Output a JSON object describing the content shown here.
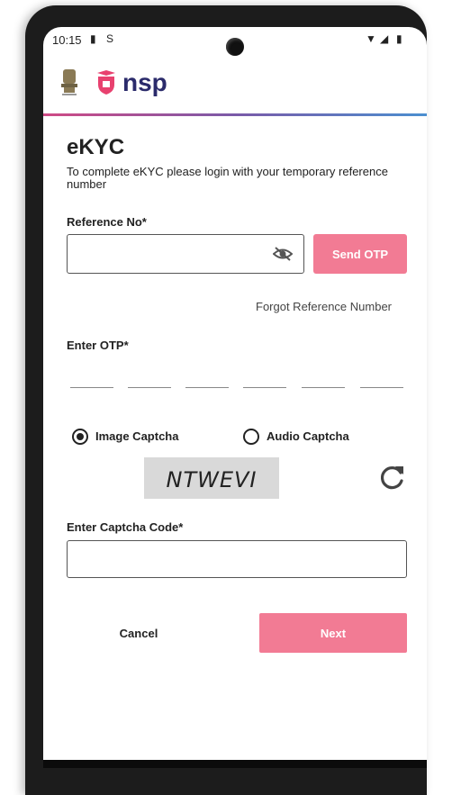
{
  "status_bar": {
    "time": "10:15",
    "icons": [
      "sim-icon",
      "notification-icon",
      "wifi-icon",
      "signal-icon",
      "battery-icon"
    ]
  },
  "header": {
    "logo_text": "nsp",
    "emblem": "national-emblem-icon",
    "colors": {
      "logo_pink": "#e8416f",
      "logo_text": "#2b2b6b"
    }
  },
  "page": {
    "title": "eKYC",
    "subtitle": "To complete eKYC please login with your temporary reference number"
  },
  "reference": {
    "label": "Reference No*",
    "value": "",
    "placeholder": "",
    "send_otp_label": "Send OTP"
  },
  "forgot_reference": "Forgot Reference Number",
  "otp": {
    "label": "Enter OTP*",
    "digits": [
      "",
      "",
      "",
      "",
      "",
      ""
    ]
  },
  "captcha": {
    "options": [
      {
        "label": "Image Captcha",
        "selected": true
      },
      {
        "label": "Audio Captcha",
        "selected": false
      }
    ],
    "image_text": "NTWEVI",
    "code_label": "Enter Captcha Code*",
    "code_value": ""
  },
  "actions": {
    "cancel_label": "Cancel",
    "next_label": "Next"
  },
  "colors": {
    "primary_button": "#f27b94",
    "header_gradient": [
      "#d04a85",
      "#7a5aa8",
      "#4b8fd0"
    ]
  }
}
